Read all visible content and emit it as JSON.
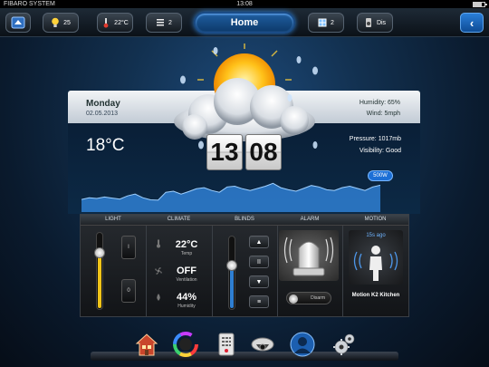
{
  "status_bar": {
    "carrier": "FIBARO SYSTEM",
    "time": "13:08"
  },
  "top_bar": {
    "home_button": "Home",
    "pills": [
      {
        "icon": "lightbulb-icon",
        "value": "25"
      },
      {
        "icon": "thermometer-icon",
        "value": "22°C"
      },
      {
        "icon": "blinds-icon",
        "value": "2"
      },
      {
        "icon": "window-icon",
        "value": "2"
      },
      {
        "icon": "speaker-icon",
        "value": "Dis"
      }
    ],
    "back_icon": "chevron-left-icon"
  },
  "weather": {
    "day": "Monday",
    "date": "02.05.2013",
    "humidity": "Humidity: 65%",
    "wind": "Wind:  5mph",
    "temperature": "18°C",
    "pressure": "Pressure:  1017mb",
    "visibility": "Visibility:  Good",
    "clock_hours": "13",
    "clock_minutes": "08",
    "power_badge": "500W",
    "icon": "partly-cloudy-icon"
  },
  "power_chart": {
    "values": [
      0.35,
      0.4,
      0.38,
      0.42,
      0.39,
      0.36,
      0.45,
      0.5,
      0.4,
      0.34,
      0.33,
      0.55,
      0.58,
      0.5,
      0.57,
      0.65,
      0.68,
      0.6,
      0.55,
      0.7,
      0.72,
      0.65,
      0.6,
      0.66,
      0.72,
      0.8,
      0.68,
      0.62,
      0.58,
      0.66,
      0.74,
      0.7,
      0.62,
      0.6,
      0.68,
      0.72,
      0.66,
      0.6,
      0.7,
      0.75
    ],
    "color": "#2f7fd2"
  },
  "dashboard": {
    "headers": {
      "light": "LIGHT",
      "climate": "CLIMATE",
      "blinds": "BLINDS",
      "alarm": "ALARM",
      "motion": "MOTION"
    },
    "light": {
      "level": 0.75,
      "switch_on": "I",
      "switch_off": "0",
      "accent": "#f0c419"
    },
    "climate": {
      "temp_value": "22°C",
      "temp_label": "Temp",
      "vent_value": "OFF",
      "vent_label": "Ventilation",
      "humidity_value": "44%",
      "humidity_label": "Humidity"
    },
    "blinds": {
      "level": 0.6,
      "up": "▲",
      "pause": "II",
      "down": "▼",
      "menu": "≡",
      "accent": "#2f7fd2"
    },
    "alarm": {
      "disarm_label": "Disarm"
    },
    "motion": {
      "ago": "15s ago",
      "name": "Motion K2 Kitchen"
    }
  },
  "dock": [
    {
      "icon": "house-icon"
    },
    {
      "icon": "color-wheel-icon"
    },
    {
      "icon": "remote-icon"
    },
    {
      "icon": "camera-icon"
    },
    {
      "icon": "user-icon"
    },
    {
      "icon": "settings-icon"
    }
  ]
}
